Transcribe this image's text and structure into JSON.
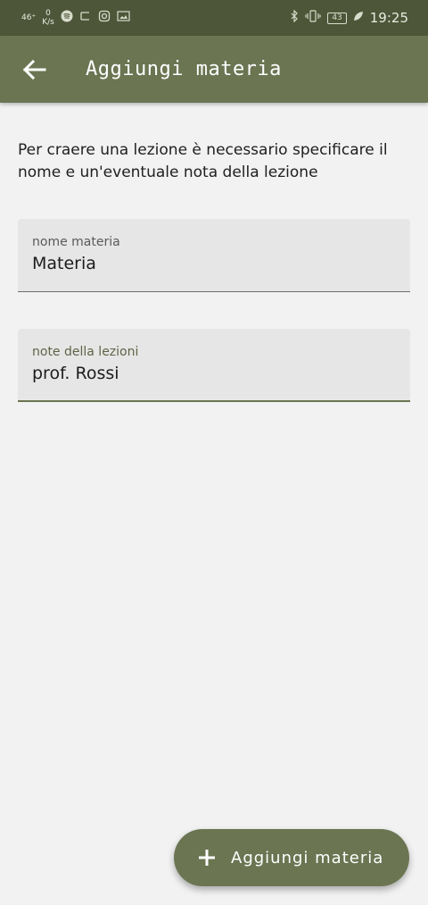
{
  "status_bar": {
    "signal": "46⁺",
    "net_speed_value": "0",
    "net_speed_unit": "K/s",
    "battery": "43",
    "time": "19:25",
    "icons": [
      "signal-icon",
      "spotify-icon",
      "cast-icon",
      "instagram-icon",
      "gallery-icon",
      "bluetooth-icon",
      "vibrate-icon",
      "battery-icon",
      "leaf-icon"
    ]
  },
  "app_bar": {
    "title": "Aggiungi materia",
    "back_icon": "arrow-back-icon"
  },
  "description": "Per craere una lezione è necessario specificare il nome e un'eventuale nota della lezione",
  "fields": [
    {
      "label": "nome materia",
      "value": "Materia"
    },
    {
      "label": "note della lezioni",
      "value": "prof. Rossi"
    }
  ],
  "fab": {
    "label": "Aggiungi materia",
    "icon": "plus-icon"
  },
  "colors": {
    "primary": "#6b7552",
    "primary_dark": "#4e5639",
    "background": "#f2f2f2",
    "field_background": "#e6e6e6"
  }
}
